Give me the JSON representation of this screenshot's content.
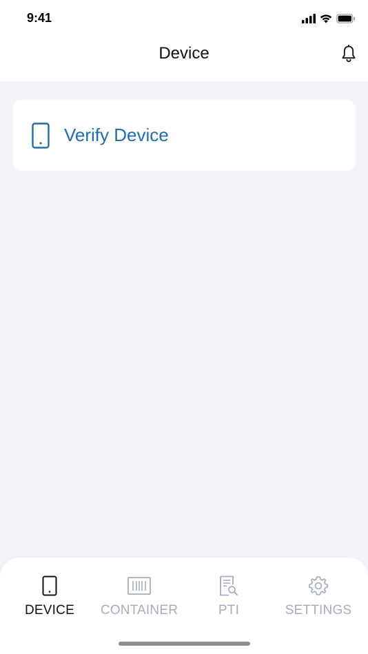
{
  "status_bar": {
    "time": "9:41"
  },
  "header": {
    "title": "Device"
  },
  "main": {
    "card": {
      "label": "Verify Device"
    }
  },
  "tabs": [
    {
      "label": "DEVICE",
      "icon": "device-icon",
      "active": true
    },
    {
      "label": "CONTAINER",
      "icon": "container-icon",
      "active": false
    },
    {
      "label": "PTI",
      "icon": "pti-icon",
      "active": false
    },
    {
      "label": "SETTINGS",
      "icon": "gear-icon",
      "active": false
    }
  ],
  "colors": {
    "accent": "#1E6DB3",
    "background": "#F2F4F8",
    "inactive_tab": "#A5ADBA"
  }
}
